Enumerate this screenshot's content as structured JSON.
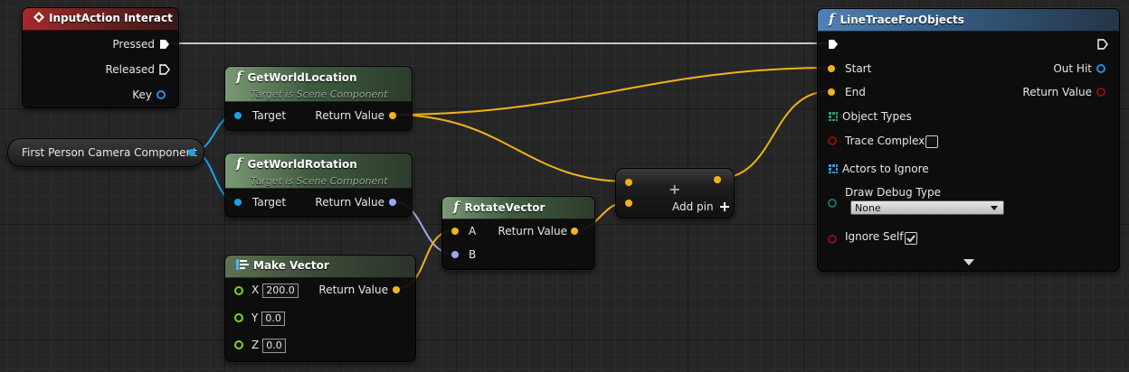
{
  "nodes": {
    "input_action": {
      "title": "InputAction Interact",
      "pressed": "Pressed",
      "released": "Released",
      "key": "Key"
    },
    "camera": {
      "label": "First Person Camera Component"
    },
    "get_world_location": {
      "title": "GetWorldLocation",
      "subtitle": "Target is Scene Component",
      "target": "Target",
      "return_value": "Return Value"
    },
    "get_world_rotation": {
      "title": "GetWorldRotation",
      "subtitle": "Target is Scene Component",
      "target": "Target",
      "return_value": "Return Value"
    },
    "make_vector": {
      "title": "Make Vector",
      "x_label": "X",
      "x_value": "200.0",
      "y_label": "Y",
      "y_value": "0.0",
      "z_label": "Z",
      "z_value": "0.0",
      "return_value": "Return Value"
    },
    "rotate_vector": {
      "title": "RotateVector",
      "a": "A",
      "b": "B",
      "return_value": "Return Value"
    },
    "add_node": {
      "add_pin": "Add pin",
      "plus_glyph": "+"
    },
    "line_trace": {
      "title": "LineTraceForObjects",
      "start": "Start",
      "end": "End",
      "out_hit": "Out Hit",
      "return_value": "Return Value",
      "object_types": "Object Types",
      "trace_complex": "Trace Complex",
      "trace_complex_checked": false,
      "actors_to_ignore": "Actors to Ignore",
      "draw_debug_type": "Draw Debug Type",
      "draw_debug_value": "None",
      "ignore_self": "Ignore Self",
      "ignore_self_checked": true
    }
  },
  "icons": {
    "event": "event-diamond-icon",
    "function": "function-f-icon",
    "make_struct": "make-struct-icon",
    "array": "array-grid-icon"
  },
  "colors": {
    "exec_wire": "#ffffff",
    "vector_wire": "#f2b21a",
    "object_wire": "#1aa3e8",
    "rotator_wire": "#9aa8ee"
  }
}
